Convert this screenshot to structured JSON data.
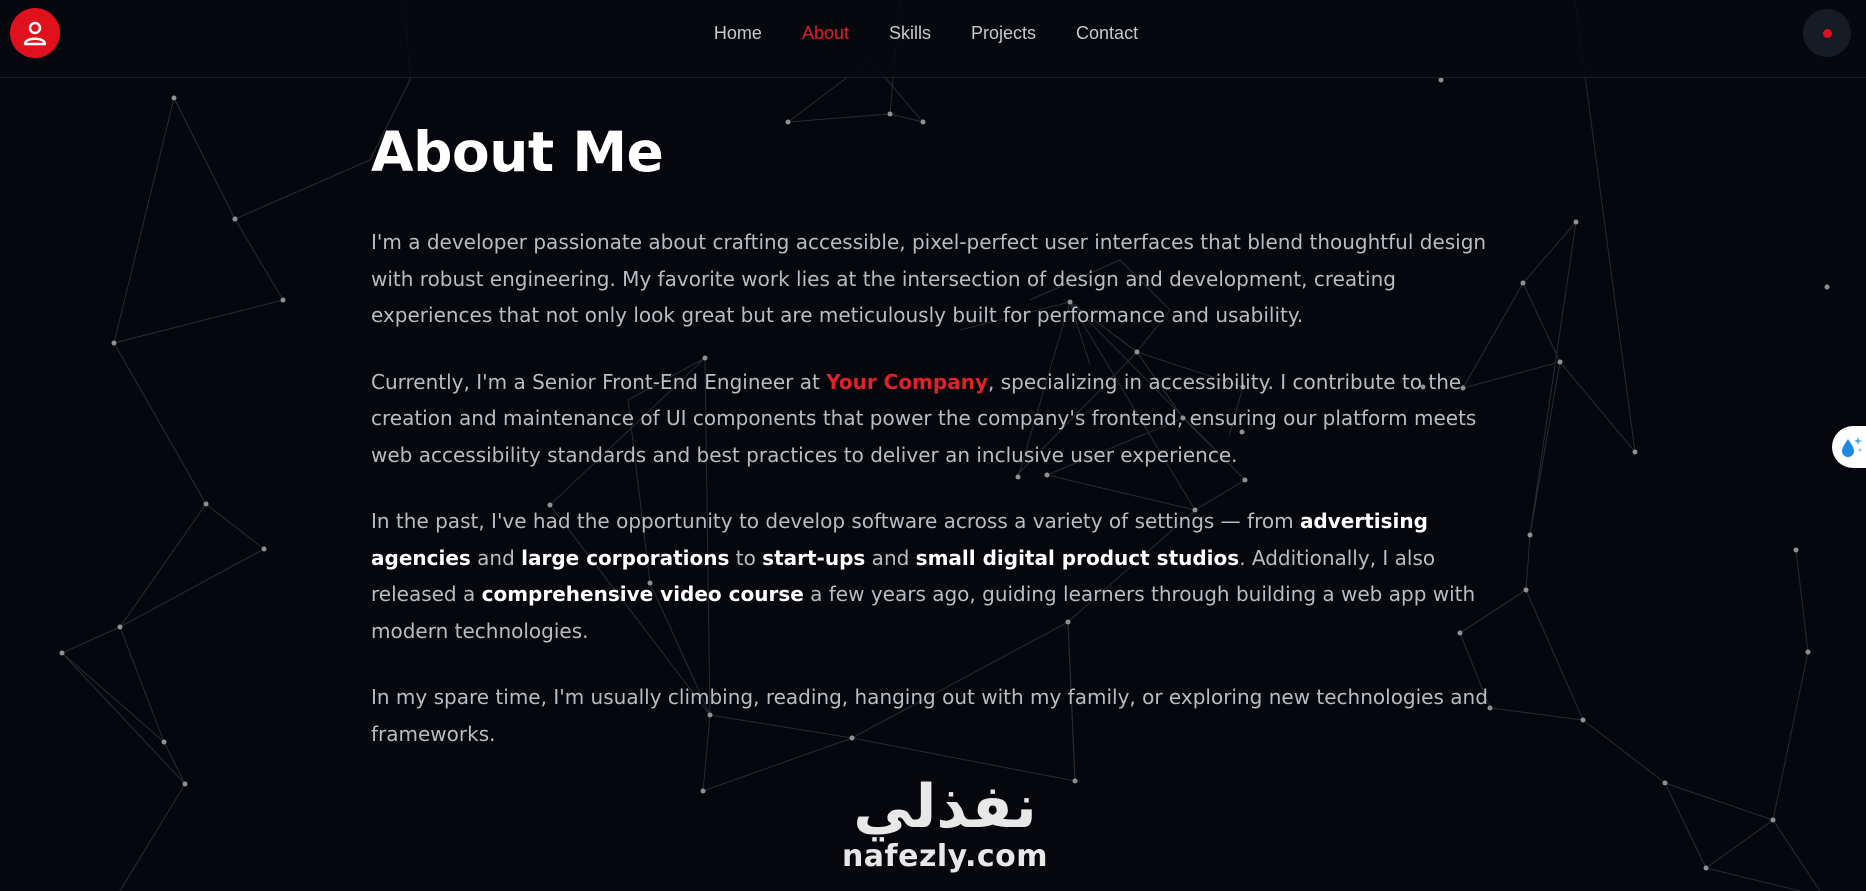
{
  "header": {
    "logo_icon": "user-icon",
    "nav": [
      {
        "label": "Home",
        "active": false
      },
      {
        "label": "About",
        "active": true
      },
      {
        "label": "Skills",
        "active": false
      },
      {
        "label": "Projects",
        "active": false
      },
      {
        "label": "Contact",
        "active": false
      }
    ],
    "theme_toggle_icon": "dot-icon"
  },
  "about": {
    "title": "About Me",
    "p1": "I'm a developer passionate about crafting accessible, pixel-perfect user interfaces that blend thoughtful design with robust engineering. My favorite work lies at the intersection of design and development, creating experiences that not only look great but are meticulously built for performance and usability.",
    "p2": {
      "before": "Currently, I'm a Senior Front-End Engineer at ",
      "company": "Your Company",
      "after": ", specializing in accessibility. I contribute to the creation and maintenance of UI components that power the company's frontend, ensuring our platform meets web accessibility standards and best practices to deliver an inclusive user experience."
    },
    "p3": {
      "t1": "In the past, I've had the opportunity to develop software across a variety of settings — from ",
      "b1": "advertising agencies",
      "t2": " and ",
      "b2": "large corporations",
      "t3": " to ",
      "b3": "start-ups",
      "t4": " and ",
      "b4": "small digital product studios",
      "t5": ". Additionally, I also released a ",
      "b5": "comprehensive video course",
      "t6": " a few years ago, guiding learners through building a web app with modern technologies."
    },
    "p4": "In my spare time, I'm usually climbing, reading, hanging out with my family, or exploring new technologies and frameworks."
  },
  "watermark": {
    "arabic": "نفذلي",
    "latin": "nafezly.com"
  },
  "side_widget": {
    "icon": "droplet-sparkle-icon"
  },
  "colors": {
    "background": "#05070d",
    "accent": "#e0202b",
    "text": "#b9bcc4",
    "heading": "#ffffff"
  }
}
